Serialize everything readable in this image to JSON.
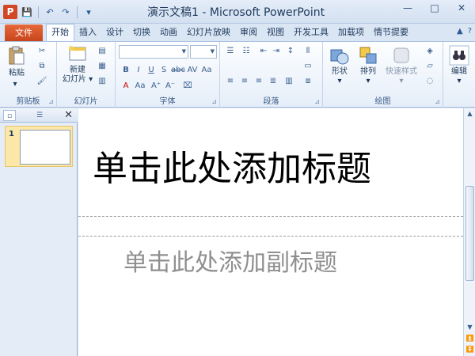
{
  "app": {
    "icon_letter": "P"
  },
  "title_bar": {
    "text": "演示文稿1 - Microsoft PowerPoint"
  },
  "quick_access": {
    "save": "💾",
    "undo": "↶",
    "redo": "↷",
    "customize": "▾"
  },
  "window_controls": {
    "minimize": "—",
    "maximize": "□",
    "close": "✕"
  },
  "ribbon_tabs": {
    "file": "文件",
    "items": [
      "开始",
      "插入",
      "设计",
      "切换",
      "动画",
      "幻灯片放映",
      "审阅",
      "视图",
      "开发工具",
      "加载项",
      "情节提要"
    ]
  },
  "ribbon_right": {
    "collapse": "▲",
    "help": "?"
  },
  "groups": {
    "clipboard": {
      "label": "剪贴板",
      "paste": "粘贴"
    },
    "slides": {
      "label": "幻灯片",
      "new_slide_line1": "新建",
      "new_slide_line2": "幻灯片"
    },
    "font": {
      "label": "字体",
      "font_name": "",
      "font_size": ""
    },
    "paragraph": {
      "label": "段落"
    },
    "drawing": {
      "label": "绘图",
      "shapes": "形状",
      "arrange": "排列",
      "quick_styles": "快速样式"
    },
    "editing": {
      "label": "编辑"
    }
  },
  "thumbnails": {
    "slide_number": "1",
    "close": "✕"
  },
  "slide": {
    "title_placeholder": "单击此处添加标题",
    "subtitle_placeholder": "单击此处添加副标题"
  },
  "scrollbar": {
    "up": "▲",
    "down": "▼",
    "prev": "⏫",
    "next": "⏬"
  },
  "colors": {
    "file_tab": "#d24726",
    "ribbon_bg": "#fdfeff",
    "thumb_selected": "#fbe7a8"
  }
}
